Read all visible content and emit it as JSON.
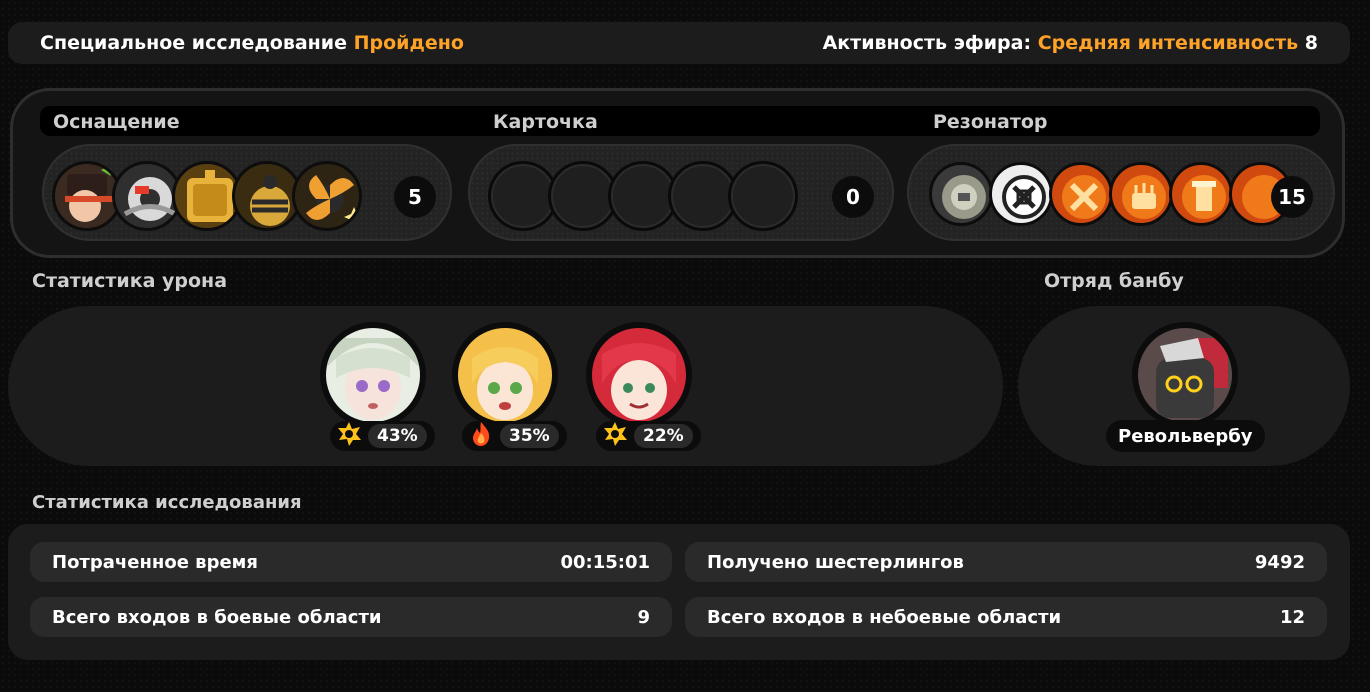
{
  "header": {
    "exploration_label": "Специальное исследование",
    "exploration_status": "Пройдено",
    "ether_label": "Активность эфира:",
    "ether_status": "Средняя интенсивность",
    "ether_level": "8"
  },
  "loadout": {
    "equipment": {
      "label": "Оснащение",
      "count": "5",
      "icons": [
        "hat-icon",
        "gear-icon",
        "shield-icon",
        "bomb-icon",
        "fan-icon"
      ]
    },
    "cards": {
      "label": "Карточка",
      "count": "0",
      "slots": 5
    },
    "resonators": {
      "label": "Резонатор",
      "count": "15",
      "icons": [
        "resonator-gray-icon",
        "resonator-white-icon",
        "resonator-cross-icon",
        "resonator-cake-icon",
        "resonator-tower-icon",
        "resonator-partial-icon"
      ]
    }
  },
  "damage": {
    "label": "Статистика урона",
    "agents": [
      {
        "name": "agent-silver-hair",
        "percent": "43%",
        "element": "physical-icon",
        "element_color": "#ffc21a"
      },
      {
        "name": "agent-blonde",
        "percent": "35%",
        "element": "fire-icon",
        "element_color": "#ff4a1a"
      },
      {
        "name": "agent-red-hair",
        "percent": "22%",
        "element": "physical-icon",
        "element_color": "#ffc21a"
      }
    ]
  },
  "bangboo": {
    "label": "Отряд банбу",
    "name": "Револьвербу"
  },
  "stats": {
    "label": "Статистика исследования",
    "rows": [
      {
        "label": "Потраченное время",
        "value": "00:15:01"
      },
      {
        "label": "Получено шестерлингов",
        "value": "9492"
      },
      {
        "label": "Всего входов в боевые области",
        "value": "9"
      },
      {
        "label": "Всего входов в небоевые области",
        "value": "12"
      }
    ]
  },
  "colors": {
    "accent": "#ffa228",
    "panel": "#1c1c1c",
    "row": "#2a2a2a"
  }
}
